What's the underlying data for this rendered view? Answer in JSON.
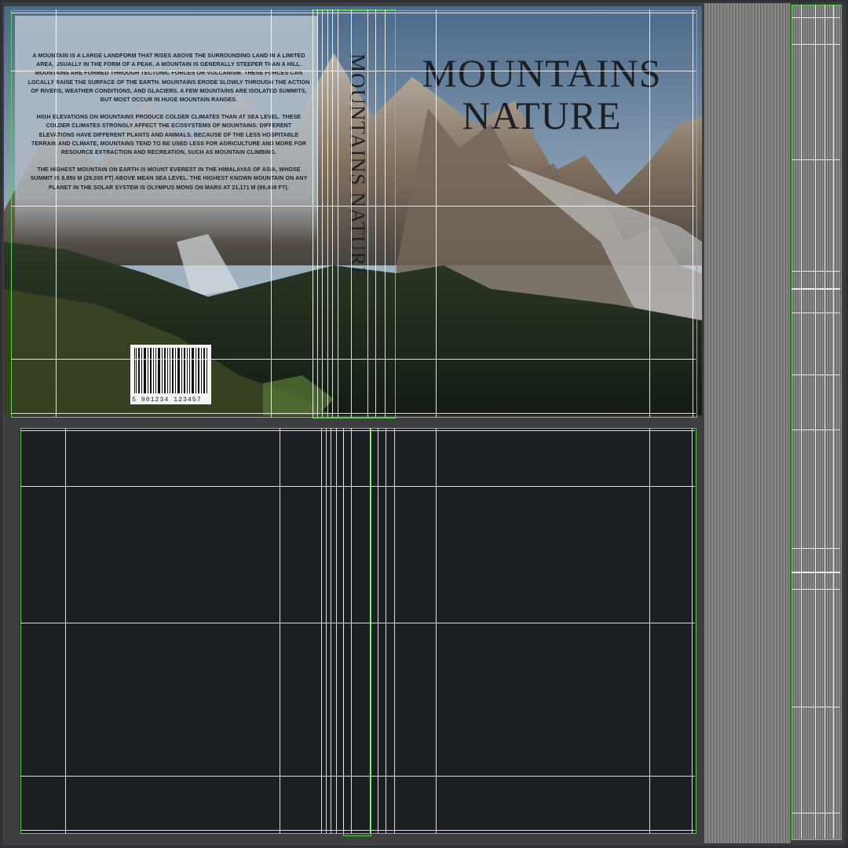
{
  "cover": {
    "back_paragraphs": [
      "A mountain is a large landform that rises above the surrounding land in a limited area, usually in the form of a peak. A mountain is generally steeper than a hill. Mountains are formed through tectonic forces or volcanism. These forces can locally raise the surface of the earth. Mountains erode slowly through the action of rivers, weather conditions, and glaciers. A few mountains are isolated summits, but most occur in huge mountain ranges.",
      "High elevations on mountains produce colder climates than at sea level. These colder climates strongly affect the ecosystems of mountains: different elevations have different plants and animals. Because of the less hospitable terrain and climate, mountains tend to be used less for agriculture and more for resource extraction and recreation, such as mountain climbing.",
      "The highest mountain on Earth is Mount Everest in the Himalayas of Asia, whose summit is 8,850 m (29,035 ft) above mean sea level. The highest known mountain on any planet in the Solar System is Olympus Mons on Mars at 21,171 m (69,459 ft)."
    ],
    "barcode_digits": "5 901234 123457",
    "spine_title": "MOUNTAINS NATURE",
    "front_title_line1": "MOUNTAINS",
    "front_title_line2": "NATURE"
  },
  "colors": {
    "guide": "#ffffff",
    "frame": "#5bd24f",
    "page_bg": "#1b1f24",
    "workspace": "#3d3e40"
  }
}
